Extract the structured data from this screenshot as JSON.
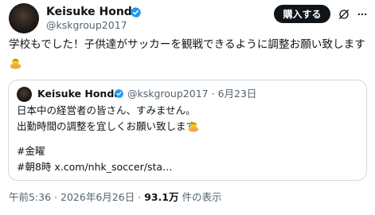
{
  "author": {
    "name": "Keisuke Honda",
    "handle": "@kskgroup2017"
  },
  "header": {
    "subscribe_label": "購入する"
  },
  "post": {
    "text": "学校もでした！子供達がサッカーを観戦できるように調整お願い致します"
  },
  "quoted_post": {
    "name": "Keisuke Honda",
    "handle": "@kskgroup2017",
    "separator": "·",
    "date": "6月23日",
    "lines": [
      "日本中の経営者の皆さん、すみません。",
      "出勤時間の調整を宜しくお願い致します",
      "#金曜",
      "#朝8時 x.com/nhk_soccer/sta…"
    ]
  },
  "footer": {
    "time": "午前5:36",
    "separator": "·",
    "date": "2026年6月26日",
    "views_count": "93.1万",
    "views_suffix": "件の表示"
  },
  "colors": {
    "verified_badge": "#1d9bf0",
    "text_primary": "#0f1419",
    "text_secondary": "#536471",
    "border": "#cfd9de",
    "button_bg": "#0f1419"
  }
}
